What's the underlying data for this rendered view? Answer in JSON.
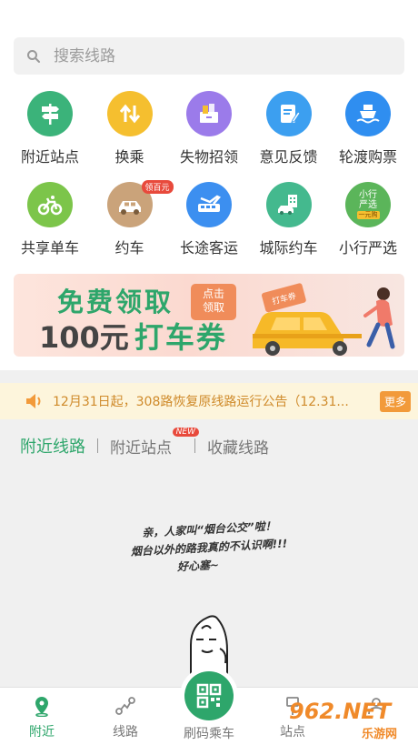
{
  "search": {
    "placeholder": "搜索线路"
  },
  "grid": {
    "row1": [
      {
        "label": "附近站点",
        "icon": "signpost-icon",
        "color": "#3bb37a"
      },
      {
        "label": "换乘",
        "icon": "transfer-arrows-icon",
        "color": "#f5bf2f"
      },
      {
        "label": "失物招领",
        "icon": "lost-found-box-icon",
        "color": "#9b7bea"
      },
      {
        "label": "意见反馈",
        "icon": "feedback-note-icon",
        "color": "#3c9ff0"
      },
      {
        "label": "轮渡购票",
        "icon": "ferry-icon",
        "color": "#2f8ef0"
      }
    ],
    "row2": [
      {
        "label": "共享单车",
        "icon": "bicycle-icon",
        "color": "#7cc54a"
      },
      {
        "label": "约车",
        "icon": "car-icon",
        "color": "#caa37a",
        "badge": "领百元"
      },
      {
        "label": "长途客运",
        "icon": "coach-bus-icon",
        "color": "#3c8ff0"
      },
      {
        "label": "城际约车",
        "icon": "intercity-car-icon",
        "color": "#44b98e"
      },
      {
        "label": "小行严选",
        "icon": "xiaoxing-yanxuan-icon",
        "color": "#5bb55a",
        "inner": [
          "小行",
          "严选"
        ],
        "tag": "一元购"
      }
    ]
  },
  "banner": {
    "title": "免费领取",
    "tag_line1": "点击",
    "tag_line2": "领取",
    "amount": "100元",
    "coupon": "打车券",
    "ticket_label": "打车券"
  },
  "notice": {
    "text": "12月31日起，308路恢复原线路运行公告（12.31...",
    "more": "更多"
  },
  "tabs": [
    {
      "label": "附近线路",
      "active": true
    },
    {
      "label": "附近站点",
      "badge": "NEW"
    },
    {
      "label": "收藏线路"
    }
  ],
  "empty_state": {
    "line1": "亲，人家叫“烟台公交”啦！",
    "line2": "烟台以外的路我真的不认识啊!!!",
    "line3": "好心塞~"
  },
  "bottom_nav": [
    {
      "label": "附近",
      "icon": "location-pin-icon",
      "active": true
    },
    {
      "label": "线路",
      "icon": "route-icon"
    },
    {
      "label": "刷码乘车",
      "icon": "qr-code-icon"
    },
    {
      "label": "站点",
      "icon": "station-sign-icon"
    },
    {
      "label": "",
      "icon": "profile-icon"
    }
  ],
  "watermark": {
    "text": "962.NET",
    "sub": "乐游网"
  },
  "colors": {
    "accent": "#2ea66b",
    "notice_text": "#cf8a2a",
    "more_bg": "#f29a3a"
  }
}
